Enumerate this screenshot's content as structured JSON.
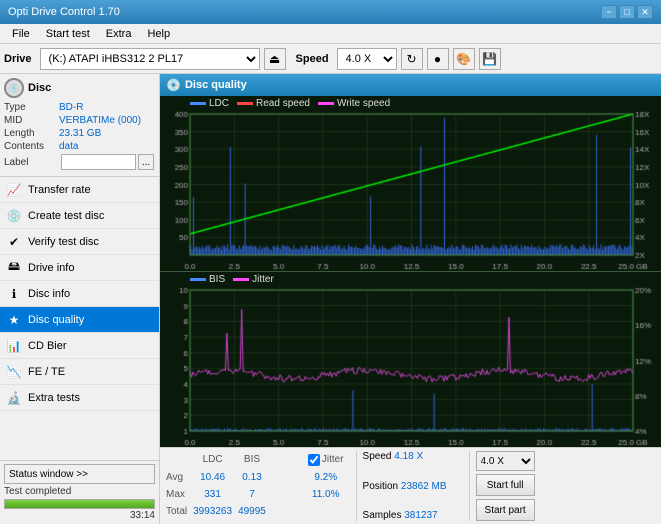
{
  "titleBar": {
    "title": "Opti Drive Control 1.70",
    "minimizeLabel": "−",
    "maximizeLabel": "□",
    "closeLabel": "✕"
  },
  "menuBar": {
    "items": [
      "File",
      "Start test",
      "Extra",
      "Help"
    ]
  },
  "driveToolbar": {
    "driveLabel": "Drive",
    "driveValue": "(K:)  ATAPI iHBS312  2 PL17",
    "speedLabel": "Speed",
    "speedValue": "4.0 X"
  },
  "discInfo": {
    "typeLabel": "Type",
    "typeValue": "BD-R",
    "midLabel": "MID",
    "midValue": "VERBATIMe (000)",
    "lengthLabel": "Length",
    "lengthValue": "23.31 GB",
    "contentsLabel": "Contents",
    "contentsValue": "data",
    "labelLabel": "Label",
    "labelValue": ""
  },
  "navItems": [
    {
      "id": "transfer-rate",
      "label": "Transfer rate",
      "icon": "📈"
    },
    {
      "id": "create-test-disc",
      "label": "Create test disc",
      "icon": "💿"
    },
    {
      "id": "verify-test-disc",
      "label": "Verify test disc",
      "icon": "✔"
    },
    {
      "id": "drive-info",
      "label": "Drive info",
      "icon": "🖴"
    },
    {
      "id": "disc-info",
      "label": "Disc info",
      "icon": "ℹ"
    },
    {
      "id": "disc-quality",
      "label": "Disc quality",
      "icon": "★",
      "active": true
    },
    {
      "id": "cd-bier",
      "label": "CD Bier",
      "icon": "📊"
    },
    {
      "id": "fe-te",
      "label": "FE / TE",
      "icon": "📉"
    },
    {
      "id": "extra-tests",
      "label": "Extra tests",
      "icon": "🔬"
    }
  ],
  "statusSection": {
    "windowLabel": "Status window >>",
    "statusText": "Test completed",
    "progressPercent": 100,
    "timeText": "33:14"
  },
  "qualityPanel": {
    "title": "Disc quality",
    "legend": {
      "ldc": "LDC",
      "ldcColor": "#4488ff",
      "readSpeed": "Read speed",
      "readSpeedColor": "#ff4444",
      "writeSpeed": "Write speed",
      "writeSpeedColor": "#ff44ff",
      "bis": "BIS",
      "bisColor": "#4488ff",
      "jitter": "Jitter",
      "jitterColor": "#ff44ff"
    },
    "topChart": {
      "yAxisMax": 400,
      "yAxisLabels": [
        "400",
        "350",
        "300",
        "250",
        "200",
        "150",
        "100",
        "50"
      ],
      "yAxisRight": [
        "18X",
        "16X",
        "14X",
        "12X",
        "10X",
        "8X",
        "6X",
        "4X",
        "2X"
      ],
      "xAxisLabels": [
        "0.0",
        "2.5",
        "5.0",
        "7.5",
        "10.0",
        "12.5",
        "15.0",
        "17.5",
        "20.0",
        "22.5",
        "25.0 GB"
      ]
    },
    "bottomChart": {
      "yAxisMax": 10,
      "yAxisLabels": [
        "10",
        "9",
        "8",
        "7",
        "6",
        "5",
        "4",
        "3",
        "2",
        "1"
      ],
      "yAxisRight": [
        "20%",
        "16%",
        "12%",
        "8%",
        "4%"
      ],
      "xAxisLabels": [
        "0.0",
        "2.5",
        "5.0",
        "7.5",
        "10.0",
        "12.5",
        "15.0",
        "17.5",
        "20.0",
        "22.5",
        "25.0 GB"
      ]
    }
  },
  "statsFooter": {
    "headers": [
      "LDC",
      "BIS",
      "",
      "Jitter",
      "Speed",
      ""
    ],
    "avgLabel": "Avg",
    "avgLDC": "10.46",
    "avgBIS": "0.13",
    "avgJitter": "9.2%",
    "maxLabel": "Max",
    "maxLDC": "331",
    "maxBIS": "7",
    "maxJitter": "11.0%",
    "totalLabel": "Total",
    "totalLDC": "3993263",
    "totalBIS": "49995",
    "speedVal": "4.18 X",
    "speedSelectVal": "4.0 X",
    "positionLabel": "Position",
    "positionVal": "23862 MB",
    "samplesLabel": "Samples",
    "samplesVal": "381237",
    "startFullLabel": "Start full",
    "startPartLabel": "Start part",
    "jitterLabel": "Jitter",
    "jitterChecked": true
  }
}
